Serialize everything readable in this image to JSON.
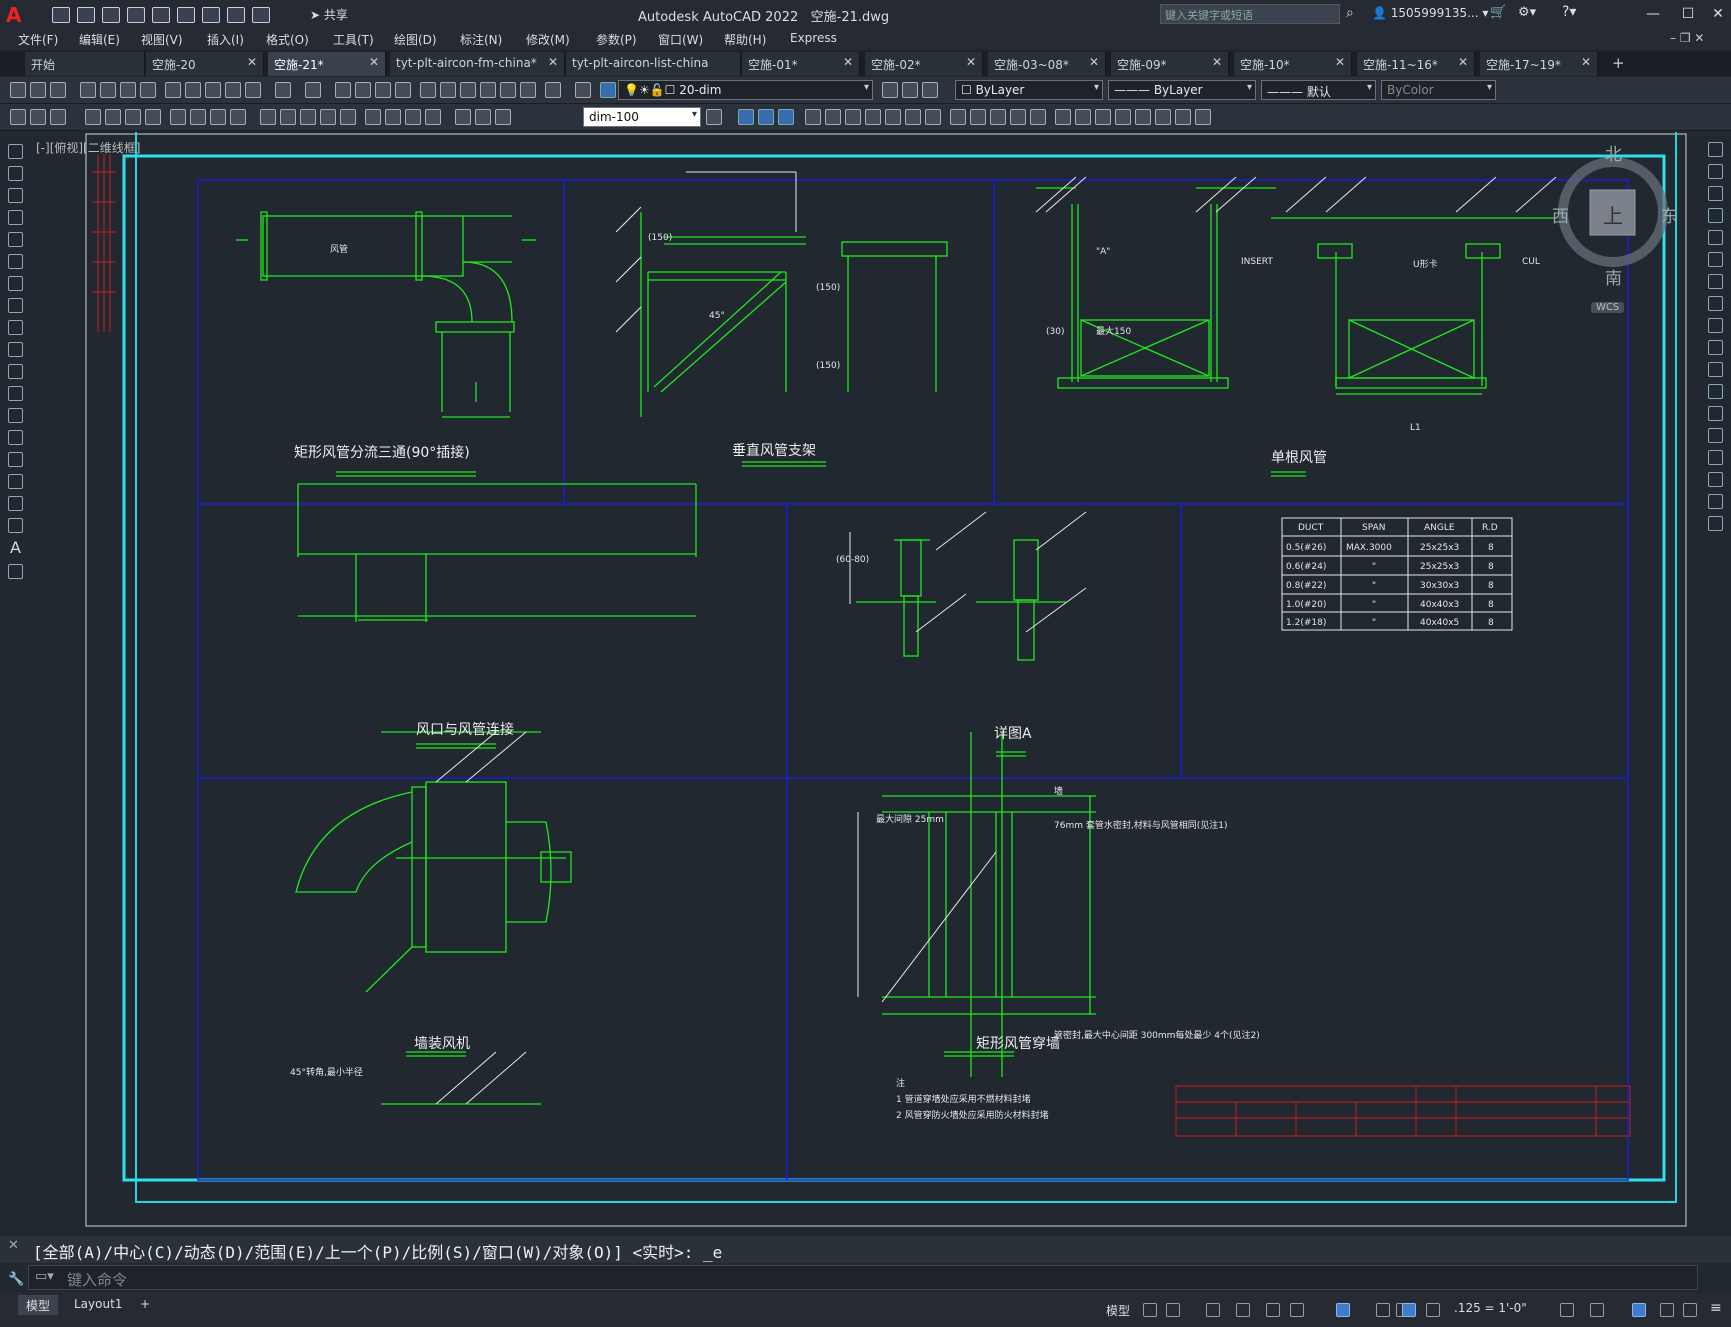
{
  "app": {
    "name": "Autodesk AutoCAD 2022",
    "document": "空施-21.dwg",
    "logo": "A"
  },
  "search": {
    "placeholder": "键入关键字或短语"
  },
  "user": {
    "name": "1505999135..."
  },
  "share_label": "共享",
  "menu": [
    "文件(F)",
    "编辑(E)",
    "视图(V)",
    "插入(I)",
    "格式(O)",
    "工具(T)",
    "绘图(D)",
    "标注(N)",
    "修改(M)",
    "参数(P)",
    "窗口(W)",
    "帮助(H)",
    "Express"
  ],
  "tabs": [
    "开始",
    "空施-20",
    "空施-21*",
    "tyt-plt-aircon-fm-china*",
    "tyt-plt-aircon-list-china",
    "空施-01*",
    "空施-02*",
    "空施-03~08*",
    "空施-09*",
    "空施-10*",
    "空施-11~16*",
    "空施-17~19*"
  ],
  "toolbar": {
    "layer": "20-dim",
    "color": "ByLayer",
    "linetype": "ByLayer",
    "lineweight": "默认",
    "plotstyle": "ByColor",
    "dimstyle": "dim-100"
  },
  "viewport_label": "[-][俯视][二维线框]",
  "viewcube": {
    "north": "北",
    "south": "南",
    "east": "东",
    "west": "西",
    "top": "上",
    "wcs": "WCS"
  },
  "drawing": {
    "titles": [
      "矩形风管分流三通(90°插接)",
      "垂直风管支架",
      "单根风管",
      "风口与风管连接",
      "详图A",
      "墙装风机",
      "矩形风管穿墙"
    ],
    "labels": {
      "duct": "风管",
      "insert": "INSERT",
      "a_mark": "\"A\"",
      "u_label": "U形卡",
      "cul": "CUL",
      "l1": "L1",
      "angle45": "45°",
      "dim150a": "(150)",
      "dim150b": "(150)",
      "dim150c": "(150)",
      "dim30": "(30)",
      "dim150x": "最大150",
      "dim6080": "(60-80)",
      "hole": "76mm 套管水密封,材料与风管相同(见注1)",
      "gap": "最大间隙 25mm",
      "seal": "管密封,最大中心间距 300mm每处最少 4个(见注2)",
      "note_title": "注",
      "note1": "1  管道穿墙处应采用不燃材料封堵",
      "note2": "2  风管穿防火墙处应采用防火材料封堵",
      "fan_angle": "45°转角,最小半径",
      "wall": "墙"
    },
    "table": {
      "headers": [
        "DUCT",
        "SPAN",
        "ANGLE",
        "R.D"
      ],
      "rows": [
        [
          "0.5(#26)",
          "MAX.3000",
          "25x25x3",
          "8"
        ],
        [
          "0.6(#24)",
          "\"",
          "25x25x3",
          "8"
        ],
        [
          "0.8(#22)",
          "\"",
          "30x30x3",
          "8"
        ],
        [
          "1.0(#20)",
          "\"",
          "40x40x3",
          "8"
        ],
        [
          "1.2(#18)",
          "\"",
          "40x40x5",
          "8"
        ]
      ]
    }
  },
  "command": {
    "history": "[全部(A)/中心(C)/动态(D)/范围(E)/上一个(P)/比例(S)/窗口(W)/对象(O)] <实时>: _e",
    "placeholder": "键入命令"
  },
  "status": {
    "model_tab": "模型",
    "layout_tab": "Layout1",
    "plus": "+",
    "model_btn": "模型",
    "scale": ".125 = 1'-0\""
  }
}
